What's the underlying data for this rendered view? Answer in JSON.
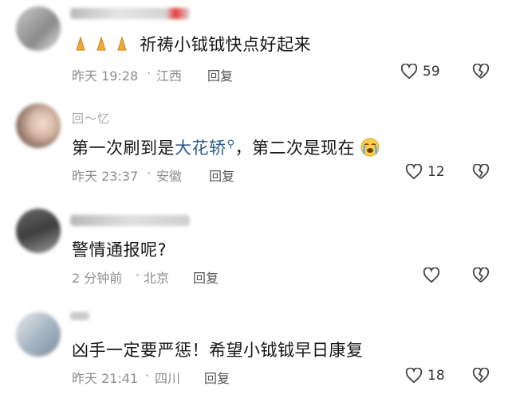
{
  "comments": [
    {
      "author": "",
      "body_emoji": [
        "folded-hands",
        "folded-hands",
        "folded-hands"
      ],
      "body_text": "祈祷小钺钺快点好起来",
      "time": "昨天 19:28",
      "location": "江西",
      "reply_label": "回复",
      "likes": "59"
    },
    {
      "author": "回～忆",
      "body_prefix": "第一次刷到是",
      "body_link": "大花轿",
      "body_suffix": "，第二次是现在",
      "body_emoji_end": "loudly-crying-face",
      "time": "昨天 23:37",
      "location": "安徽",
      "reply_label": "回复",
      "likes": "12"
    },
    {
      "author": "",
      "body_text": "警情通报呢?",
      "time": "2 分钟前",
      "location": "北京",
      "reply_label": "回复",
      "likes": ""
    },
    {
      "author": "",
      "body_text": "凶手一定要严惩！希望小钺钺早日康复",
      "time": "昨天 21:41",
      "location": "四川",
      "reply_label": "回复",
      "likes": "18"
    }
  ],
  "colors": {
    "link": "#2d5a8c",
    "meta": "#8e8e8e",
    "text": "#161616"
  }
}
